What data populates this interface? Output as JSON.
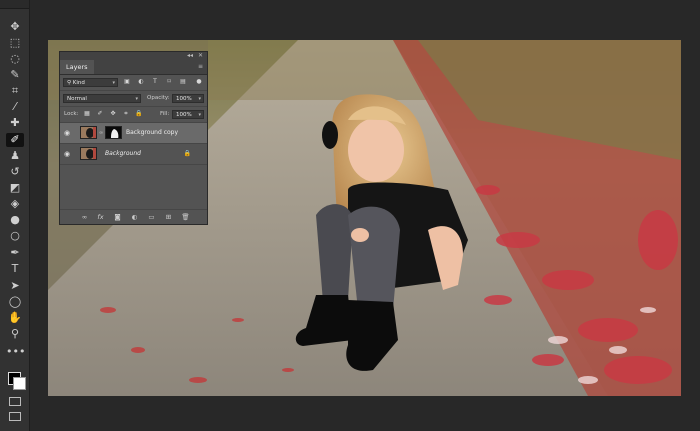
{
  "layers_panel": {
    "tab": "Layers",
    "filter_kind": "Kind",
    "blend_mode": "Normal",
    "opacity_label": "Opacity:",
    "opacity_value": "100%",
    "lock_label": "Lock:",
    "fill_label": "Fill:",
    "fill_value": "100%",
    "layers": [
      {
        "name": "Background copy",
        "selected": true
      },
      {
        "name": "Background",
        "selected": false
      }
    ]
  },
  "icons": {
    "toolbar": [
      "move-icon",
      "marquee-icon",
      "lasso-icon",
      "quick-select-icon",
      "crop-icon",
      "eyedropper-icon",
      "healing-icon",
      "brush-icon",
      "stamp-icon",
      "history-brush-icon",
      "eraser-icon",
      "gradient-icon",
      "blur-icon",
      "dodge-icon",
      "pen-icon",
      "type-icon",
      "path-select-icon",
      "shape-icon",
      "hand-icon",
      "zoom-icon",
      "more-icon"
    ]
  },
  "colors": {
    "workspace": "#282828",
    "panel": "#535353",
    "foreground_swatch": "#000000",
    "background_swatch": "#ffffff"
  }
}
